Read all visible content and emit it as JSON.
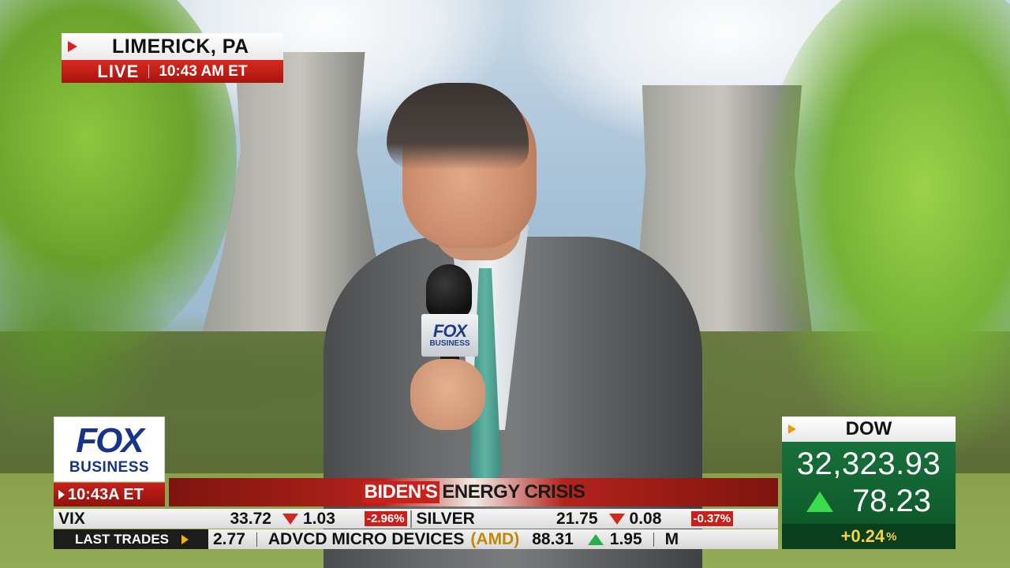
{
  "location": {
    "place": "LIMERICK, PA",
    "live": "LIVE",
    "time": "10:43 AM ET"
  },
  "microphone_flag": {
    "line1": "FOX",
    "line2": "BUSINESS"
  },
  "network_logo": {
    "line1": "FOX",
    "line2": "BUSINESS",
    "clock": "10:43A ET"
  },
  "headline": {
    "highlight": "BIDEN'S",
    "rest": "ENERGY CRISIS"
  },
  "ticker_top": {
    "items": [
      {
        "symbol": "VIX",
        "price": "33.72",
        "direction": "down",
        "change": "1.03",
        "percent": "-2.96%"
      },
      {
        "symbol": "SILVER",
        "price": "21.75",
        "direction": "down",
        "change": "0.08",
        "percent": "-0.37%"
      }
    ]
  },
  "ticker_bottom": {
    "label": "LAST TRADES",
    "partial_left": "2.77",
    "item": {
      "prefix": "ADVCD MICRO DEVICES",
      "symbol": "(AMD)",
      "price": "88.31",
      "direction": "up",
      "change": "1.95"
    },
    "partial_right": "M"
  },
  "index_box": {
    "name": "DOW",
    "value": "32,323.93",
    "direction": "up",
    "change": "78.23",
    "percent_value": "+0.24",
    "percent_sign": "%"
  },
  "colors": {
    "fox_blue": "#17338a",
    "alert_red": "#c8201a",
    "market_green": "#17703a",
    "up_green": "#3cdc4a",
    "down_red": "#d12a20",
    "highlight_yellow": "#f2d24a"
  }
}
